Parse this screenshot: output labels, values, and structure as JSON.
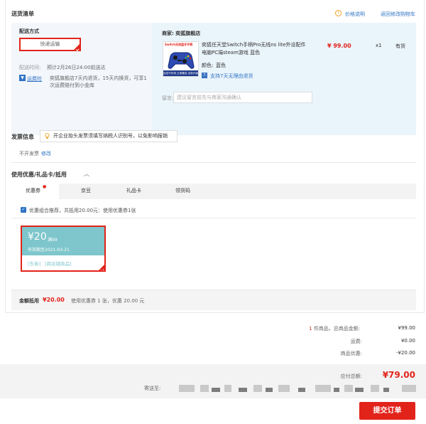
{
  "header": {
    "title": "送货清单",
    "price_note": "价格说明",
    "return_cart": "返回修改购物车"
  },
  "shipping": {
    "label": "配送方式",
    "method": "快递运输",
    "time_label": "配送时间:",
    "time_value": "预计2月26日24:00前送达",
    "badge": "运费险",
    "policy": "奕狐旗舰店7天内退货，15天内换货，可享1次运费赔付到小金库"
  },
  "shop": {
    "name": "商家: 奕狐旗舰店",
    "product_title": "奕狐任天堂Switch手柄Pro无线ns lite外设配件电脑PC端steam游戏 蓝色",
    "price": "¥ 99.00",
    "qty": "x1",
    "stock": "有货",
    "color_label": "颜色:",
    "color_value": "蓝色",
    "return_label": "支持7天无理由退货",
    "note_label": "留言:",
    "note_placeholder": "建议留言前先与商家沟通确认",
    "thumb_banner": "Switch无线蓝牙手柄",
    "thumb_caption": "连发不好用 正常兼容 全新升级"
  },
  "invoice": {
    "title": "发票信息",
    "tip": "开企业抬头发票须填写纳税人识别号，以免影响报销",
    "status": "不开发票",
    "modify": "修改"
  },
  "coupons": {
    "title": "使用优惠/礼品卡/抵用",
    "tabs": [
      "优惠券",
      "京豆",
      "礼品卡",
      "领货码"
    ],
    "recommend": "优惠组合推荐，共抵用20.00元：使用优惠券1张",
    "coupon_amount": "¥20",
    "coupon_condition": "满99",
    "coupon_expiry": "有效期至2021-03-21",
    "coupon_tag1": "[东券]",
    "coupon_tag2": "[商店铺商品]",
    "summary_label": "金额抵用",
    "summary_amount": "¥20.00",
    "summary_detail": "使用优惠券 1 张，优惠 20.00 元"
  },
  "totals": {
    "count_prefix": "1",
    "count_text": "件商品，总商品金额:",
    "goods_amount": "¥99.00",
    "freight_label": "运费:",
    "freight": "¥0.00",
    "discount_label": "商品优惠:",
    "discount": "-¥20.00"
  },
  "checkout": {
    "payable_label": "应付总额:",
    "payable": "¥79.00",
    "ship_to_label": "寄送至:",
    "submit": "提交订单"
  }
}
